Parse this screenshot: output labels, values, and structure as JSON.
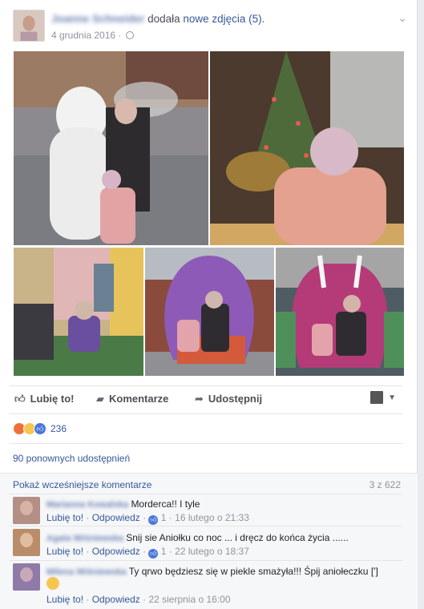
{
  "post": {
    "author": "Joanne Schneider",
    "verb": "dodała",
    "link": "nowe zdjęcia (5).",
    "date": "4 grudnia 2016",
    "separator": "·"
  },
  "actions": {
    "like": "Lubię to!",
    "comment": "Komentarze",
    "share": "Udostępnij"
  },
  "reactions": {
    "count": "236"
  },
  "shares": "90 ponownych udostępnień",
  "comments_header": {
    "previous": "Pokaż wcześniejsze komentarze",
    "count": "3 z 622"
  },
  "comments": [
    {
      "author": "Marianna Kowalska",
      "text": "Morderca!! I tyle",
      "like": "Lubię to!",
      "reply": "Odpowiedz",
      "likes": "1",
      "time": "16 lutego o 21:33"
    },
    {
      "author": "Agata Wiśniewska",
      "text": "Snij sie Aniołku co noc ... i dręcz do końca życia ......",
      "like": "Lubię to!",
      "reply": "Odpowiedz",
      "likes": "1",
      "time": "22 lutego o 18:37"
    },
    {
      "author": "Milena Wiśniewska",
      "text": "Ty qrwo będziesz się w piekle smażyła!!! Śpij aniołeczku [']",
      "like": "Lubię to!",
      "reply": "Odpowiedz",
      "time": "22 sierpnia o 16:00"
    }
  ],
  "icons": [
    "chevron-down-icon",
    "globe-icon",
    "like-icon",
    "comment-icon",
    "share-icon"
  ]
}
